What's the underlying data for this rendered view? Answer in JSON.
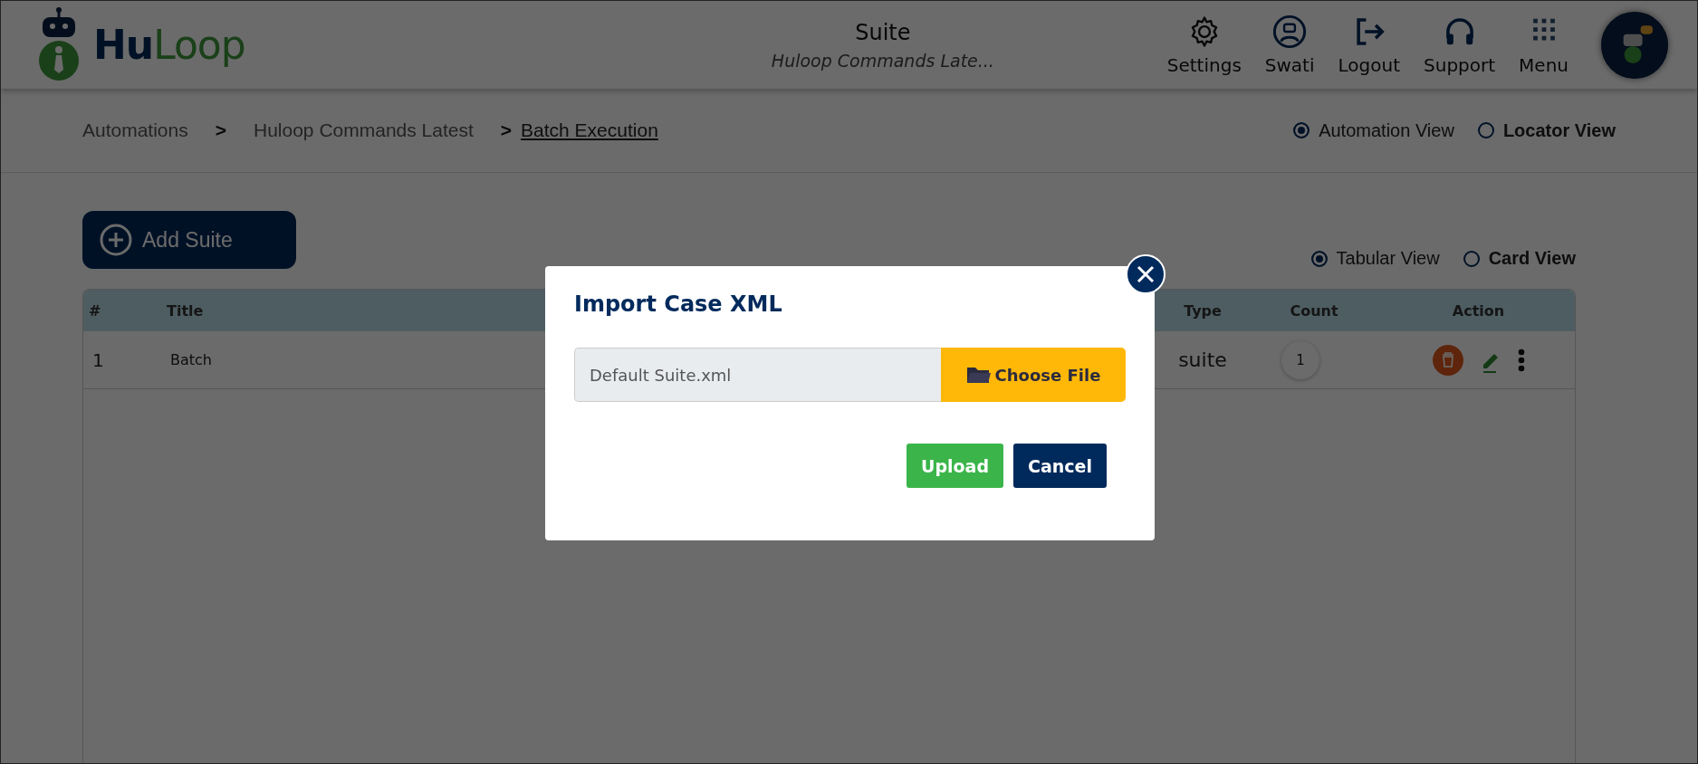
{
  "header": {
    "brand": "**Hu**Loop",
    "title": "Suite",
    "subtitle": "Huloop Commands Late...",
    "nav": [
      {
        "label": "Settings"
      },
      {
        "label": "Swati"
      },
      {
        "label": "Logout"
      },
      {
        "label": "Support"
      },
      {
        "label": "Menu"
      }
    ]
  },
  "breadcrumb": [
    {
      "label": "Automations",
      "kind": "text"
    },
    {
      "label": ">",
      "kind": "separator"
    },
    {
      "label": "Huloop Commands Latest",
      "kind": "text"
    },
    {
      "label": ">",
      "kind": "separator"
    },
    {
      "label": "Batch Execution",
      "kind": "link"
    }
  ],
  "view_toggle": [
    {
      "label": "Automation View",
      "selected": true
    },
    {
      "label": "Locator View",
      "selected": false
    }
  ],
  "add_button": "Add Suite",
  "display_toggle": [
    {
      "label": "Tabular View",
      "selected": true
    },
    {
      "label": "Card View",
      "selected": false
    }
  ],
  "table": {
    "columns": [
      "#",
      "Title",
      "Type",
      "Count",
      "Action"
    ],
    "rows": [
      {
        "number": "1",
        "title": "Batch",
        "type": "suite",
        "count": "1"
      }
    ]
  },
  "dialog": {
    "title": "Import Case XML",
    "file_name": "Default Suite.xml",
    "choose_label": "Choose File",
    "buttons": [
      {
        "label": "Upload",
        "kind": "primary"
      },
      {
        "label": "Cancel",
        "kind": "secondary"
      }
    ]
  }
}
